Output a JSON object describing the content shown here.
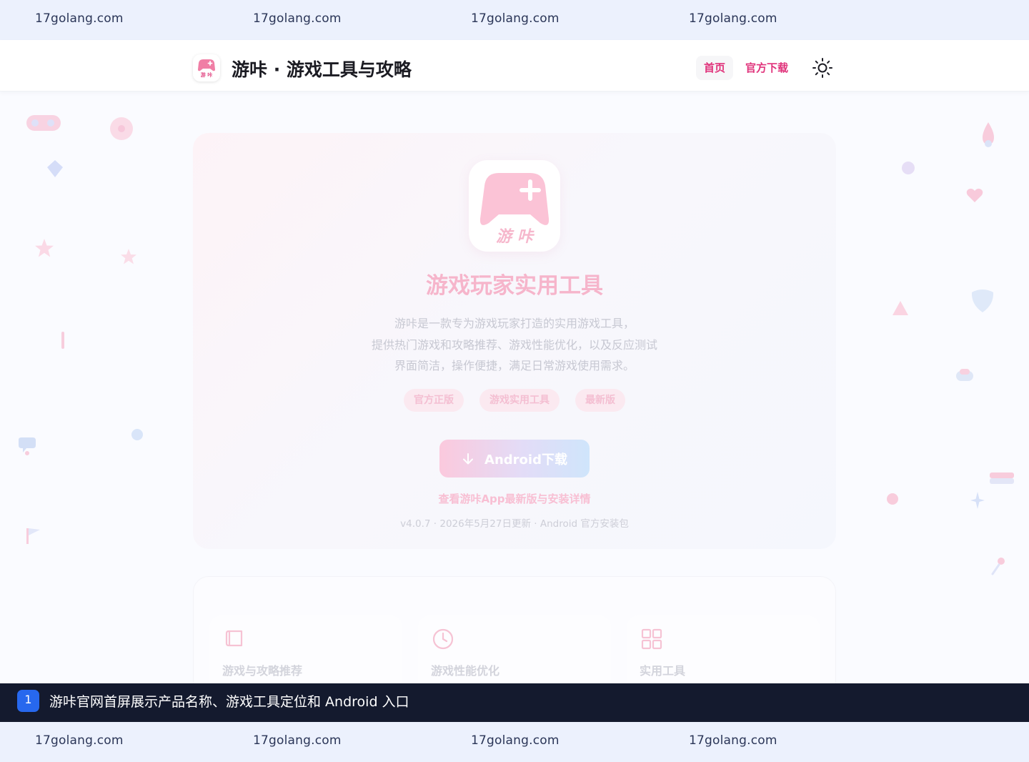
{
  "watermark": {
    "top": [
      "17golang.com",
      "17golang.com",
      "17golang.com",
      "17golang.com"
    ],
    "bottom": [
      "17golang.com",
      "17golang.com",
      "17golang.com",
      "17golang.com"
    ]
  },
  "header": {
    "logo_text": "游 咔",
    "site_title": "游咔 · 游戏工具与攻略",
    "nav": {
      "home": "首页",
      "download": "官方下载"
    }
  },
  "hero": {
    "app_icon_text": "游 咔",
    "title": "游戏玩家实用工具",
    "description": [
      "游咔是一款专为游戏玩家打造的实用游戏工具，",
      "提供热门游戏和攻略推荐、游戏性能优化，以及反应测试",
      "界面简洁，操作便捷，满足日常游戏使用需求。"
    ],
    "tags": [
      "官方正版",
      "游戏实用工具",
      "最新版"
    ],
    "download_button": "Android下载",
    "detail_link": "查看游咔App最新版与安装详情",
    "meta": "v4.0.7 · 2026年5月27日更新 · Android 官方安装包"
  },
  "features": [
    {
      "label": "游戏与攻略推荐",
      "icon": "book-icon"
    },
    {
      "label": "游戏性能优化",
      "icon": "clock-icon"
    },
    {
      "label": "实用工具",
      "icon": "grid-icon"
    }
  ],
  "caption": {
    "number": "1",
    "text": "游咔官网首屏展示产品名称、游戏工具定位和 Android 入口"
  },
  "colors": {
    "accent": "#e0337b",
    "watermark_bg": "#ecf1fd",
    "caption_bg": "#141a2e",
    "caption_badge": "#2768ee"
  }
}
